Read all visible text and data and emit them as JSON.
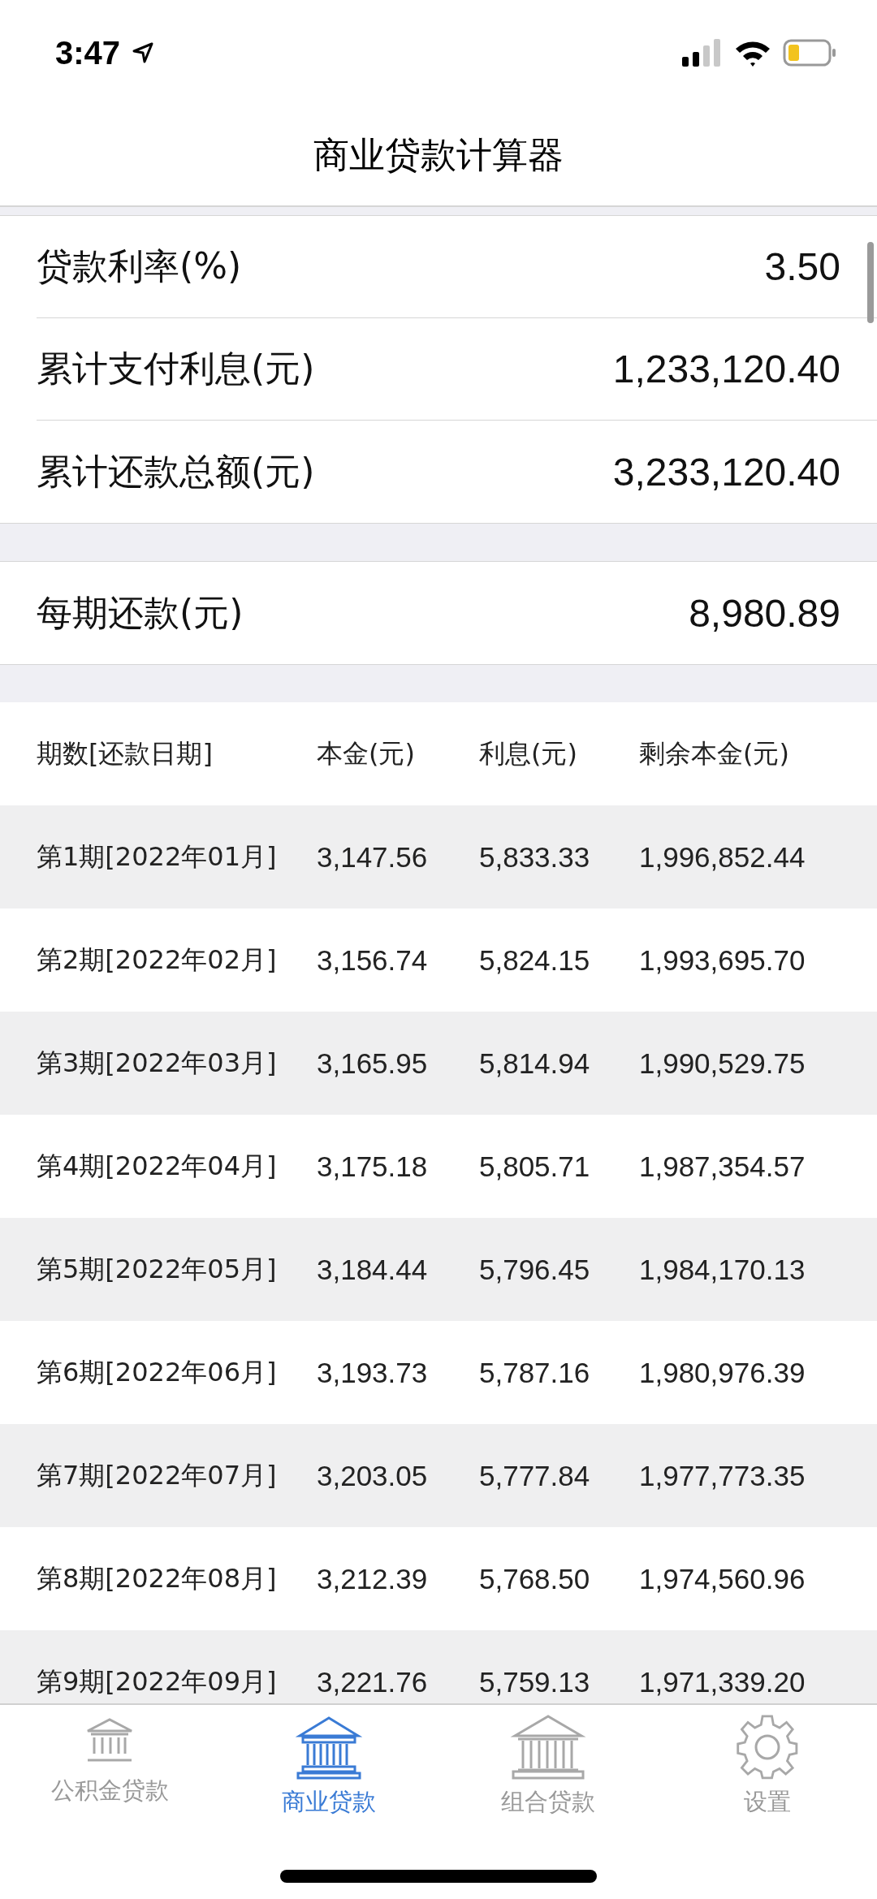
{
  "status_bar": {
    "time": "3:47"
  },
  "title": "商业贷款计算器",
  "summary": [
    {
      "label": "贷款利率(%)",
      "value": "3.50"
    },
    {
      "label": "累计支付利息(元)",
      "value": "1,233,120.40"
    },
    {
      "label": "累计还款总额(元)",
      "value": "3,233,120.40"
    }
  ],
  "monthly": {
    "label": "每期还款(元)",
    "value": "8,980.89"
  },
  "table": {
    "columns": [
      "期数[还款日期]",
      "本金(元)",
      "利息(元)",
      "剩余本金(元)"
    ],
    "rows": [
      [
        "第1期[2022年01月]",
        "3,147.56",
        "5,833.33",
        "1,996,852.44"
      ],
      [
        "第2期[2022年02月]",
        "3,156.74",
        "5,824.15",
        "1,993,695.70"
      ],
      [
        "第3期[2022年03月]",
        "3,165.95",
        "5,814.94",
        "1,990,529.75"
      ],
      [
        "第4期[2022年04月]",
        "3,175.18",
        "5,805.71",
        "1,987,354.57"
      ],
      [
        "第5期[2022年05月]",
        "3,184.44",
        "5,796.45",
        "1,984,170.13"
      ],
      [
        "第6期[2022年06月]",
        "3,193.73",
        "5,787.16",
        "1,980,976.39"
      ],
      [
        "第7期[2022年07月]",
        "3,203.05",
        "5,777.84",
        "1,977,773.35"
      ],
      [
        "第8期[2022年08月]",
        "3,212.39",
        "5,768.50",
        "1,974,560.96"
      ],
      [
        "第9期[2022年09月]",
        "3,221.76",
        "5,759.13",
        "1,971,339.20"
      ]
    ]
  },
  "tabs": [
    {
      "label": "公积金贷款",
      "kind": "bank-small",
      "selected": false
    },
    {
      "label": "商业贷款",
      "kind": "bank",
      "selected": true
    },
    {
      "label": "组合贷款",
      "kind": "bank-large",
      "selected": false
    },
    {
      "label": "设置",
      "kind": "gear",
      "selected": false
    }
  ]
}
